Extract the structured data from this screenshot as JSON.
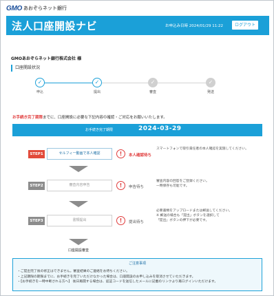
{
  "logo": {
    "mark": "GMO",
    "text": "あおぞらネット銀行"
  },
  "header": {
    "title": "法人口座開設ナビ",
    "date_label": "お申込み日時 2024/01/29 11:22",
    "logout_label": "ログアウト"
  },
  "company_name": "GMOあおぞらネット銀行株式会社 様",
  "section_title": "口座開設状況",
  "progress": {
    "steps": [
      {
        "label": "申込",
        "state": "done"
      },
      {
        "label": "提出",
        "state": "done"
      },
      {
        "label": "審査",
        "state": "pending"
      },
      {
        "label": "発送",
        "state": "pending"
      }
    ],
    "check_glyph": "✓"
  },
  "notice": {
    "emphasis": "お手続き完了期限",
    "rest": "までに、口座開設に必要な下記内容の確認・ご対応をお願いいたします。"
  },
  "deadline": {
    "label": "お手続き完了期限",
    "date": "2024-03-29"
  },
  "steps": [
    {
      "tag": "STEP1",
      "button": "セルフィー動画で本人確認",
      "status": "本人確認待ち",
      "description": "スマートフォンで取引責任者の本人確認を実施してください。"
    },
    {
      "tag": "STEP2",
      "button": "審査内容申告",
      "status": "申告待ち",
      "description_lines": [
        "審査内容の回答をご登録ください。",
        "一時保存も可能です。"
      ]
    },
    {
      "tag": "STEP3",
      "button": "書類提出",
      "status": "提出待ち",
      "description_lines": [
        "必要書類をアップロードまたは郵送してください。",
        "※ 郵送の場合も「提出」ボタンを選択して",
        "「提出」ボタンの押下が必要です。"
      ]
    }
  ],
  "finish_label": "口座開設審査",
  "caution": {
    "title": "ご注意事項",
    "items": [
      "・ご提出完了後の修正はできません。審査結果のご連絡をお待ちください。",
      "・上記期限の期限までに、お手続きを完了いただけなかった場合は、口座開設のお申し込みを取消させていただきます。",
      "・【お手続きを一時中断される方へ】 後日再開する場合は、認証コードを送信したメールに記載のリンクより再ログインいただけます。"
    ]
  },
  "colors": {
    "brand": "#1ba0d8",
    "alert": "#e03b3b"
  }
}
